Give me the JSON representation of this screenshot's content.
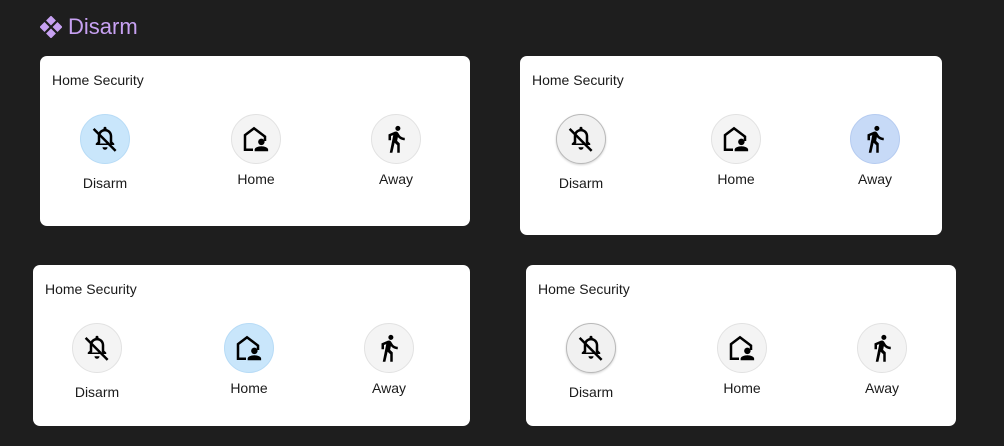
{
  "header": {
    "title": "Disarm",
    "icon": "component-diamonds-icon",
    "accent": "#c7a1f2"
  },
  "cards": [
    {
      "title": "Home Security",
      "buttons": [
        {
          "label": "Disarm",
          "icon": "bell-off-icon",
          "state": "active"
        },
        {
          "label": "Home",
          "icon": "home-person-icon",
          "state": "inactive"
        },
        {
          "label": "Away",
          "icon": "walking-person-icon",
          "state": "inactive"
        }
      ]
    },
    {
      "title": "Home Security",
      "buttons": [
        {
          "label": "Disarm",
          "icon": "bell-off-icon",
          "state": "inactive"
        },
        {
          "label": "Home",
          "icon": "home-person-icon",
          "state": "inactive"
        },
        {
          "label": "Away",
          "icon": "walking-person-icon",
          "state": "active"
        }
      ]
    },
    {
      "title": "Home Security",
      "buttons": [
        {
          "label": "Disarm",
          "icon": "bell-off-icon",
          "state": "inactive"
        },
        {
          "label": "Home",
          "icon": "home-person-icon",
          "state": "active"
        },
        {
          "label": "Away",
          "icon": "walking-person-icon",
          "state": "inactive"
        }
      ]
    },
    {
      "title": "Home Security",
      "buttons": [
        {
          "label": "Disarm",
          "icon": "bell-off-icon",
          "state": "inactive"
        },
        {
          "label": "Home",
          "icon": "home-person-icon",
          "state": "inactive"
        },
        {
          "label": "Away",
          "icon": "walking-person-icon",
          "state": "inactive"
        }
      ]
    }
  ],
  "colors": {
    "background": "#1e1e1e",
    "card": "#ffffff",
    "active_blue": "#c9e6fb",
    "active_periwinkle": "#c7daf7"
  }
}
